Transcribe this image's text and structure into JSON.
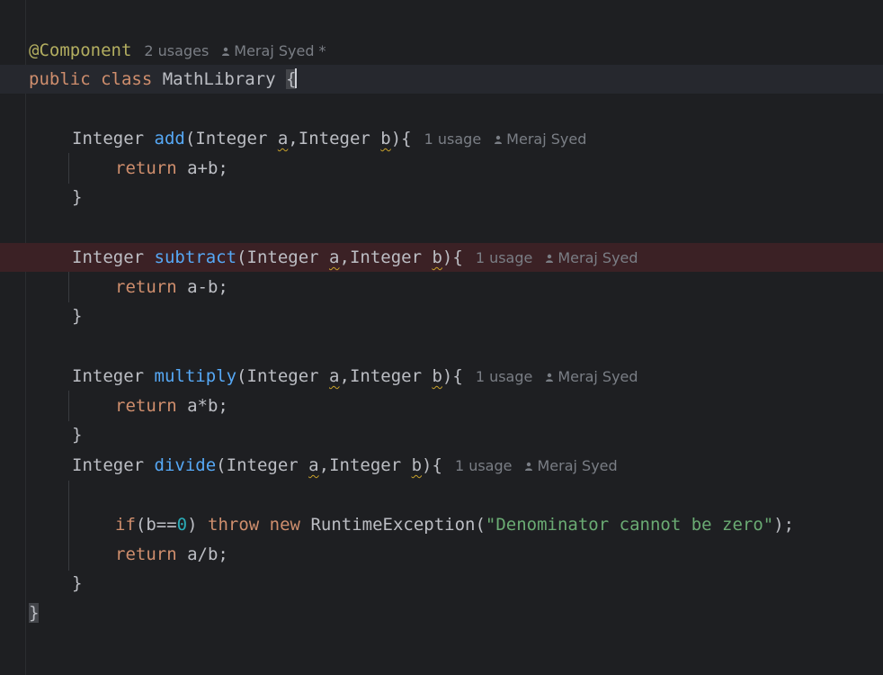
{
  "editor": {
    "class_annotation": "@Component",
    "class_usages": "2 usages",
    "class_author": "Meraj Syed *",
    "class_keywords": "public class",
    "class_name": "MathLibrary",
    "open_brace": "{",
    "close_brace": "}",
    "methods": [
      {
        "return_type": "Integer",
        "name": "add",
        "param_type_a": "Integer",
        "param_a": "a",
        "param_type_b": "Integer",
        "param_b": "b",
        "usages": "1 usage",
        "author": "Meraj Syed",
        "body": "a+b;"
      },
      {
        "return_type": "Integer",
        "name": "subtract",
        "param_type_a": "Integer",
        "param_a": "a",
        "param_type_b": "Integer",
        "param_b": "b",
        "usages": "1 usage",
        "author": "Meraj Syed",
        "body": "a-b;"
      },
      {
        "return_type": "Integer",
        "name": "multiply",
        "param_type_a": "Integer",
        "param_a": "a",
        "param_type_b": "Integer",
        "param_b": "b",
        "usages": "1 usage",
        "author": "Meraj Syed",
        "body": "a*b;"
      },
      {
        "return_type": "Integer",
        "name": "divide",
        "param_type_a": "Integer",
        "param_a": "a",
        "param_type_b": "Integer",
        "param_b": "b",
        "usages": "1 usage",
        "author": "Meraj Syed",
        "body": "a/b;"
      }
    ],
    "keyword_return": "return",
    "divide_if": "if",
    "divide_cond_left": "(b==",
    "divide_cond_num": "0",
    "divide_cond_right": ")",
    "keyword_throw": "throw",
    "keyword_new": "new",
    "exception_class": "RuntimeException(",
    "exception_message": "\"Denominator cannot be zero\"",
    "exception_end": ");"
  },
  "colors": {
    "background": "#1e1f22",
    "keyword": "#cf8e6d",
    "function": "#56a8f5",
    "annotation": "#b3ae60",
    "string": "#6aab73",
    "number": "#2aacb8",
    "breakpoint_line": "#3b2125"
  }
}
